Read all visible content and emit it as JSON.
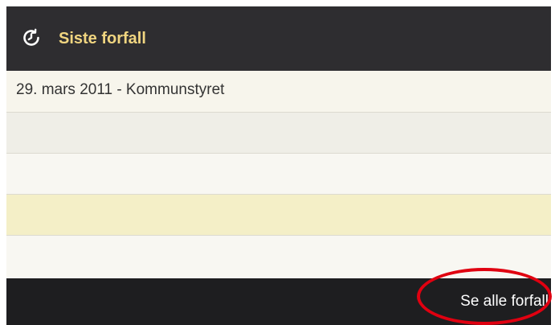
{
  "panel": {
    "title": "Siste forfall",
    "icon": "clock-refresh-icon",
    "title_color": "#f0d580"
  },
  "rows": [
    {
      "label": "29. mars 2011 - Kommunstyret"
    },
    {
      "label": ""
    },
    {
      "label": ""
    },
    {
      "label": ""
    },
    {
      "label": ""
    }
  ],
  "footer": {
    "link_label": "Se alle forfall"
  },
  "annotation": {
    "color": "#e00010"
  }
}
